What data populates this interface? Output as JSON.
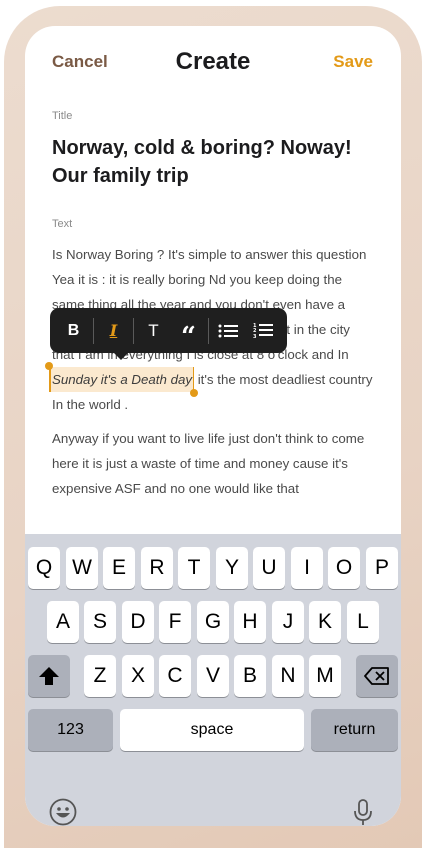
{
  "header": {
    "cancel": "Cancel",
    "title": "Create",
    "save": "Save"
  },
  "form": {
    "title_label": "Title",
    "title_value": "Norway, cold & boring? Noway! Our family trip",
    "text_label": "Text",
    "p1_line1": "Is Norway Boring ? It's simple to answer this question",
    "p1_line2": "Yea it is : it is really boring Nd you keep doing the",
    "p1_line3": "same thing all the year and you don't even have a",
    "p1_line4": "what in the city",
    "p1_line5": "that I am in everything I is close at 8 o'clock and In",
    "selected": "Sunday it's a Death day",
    "p1_after": " it's the most deadliest country",
    "p1_line7": "In the world .",
    "p2": "Anyway if you want to live life just don't think to come here it is just a waste of time and money cause it's expensive ASF and no one would like that"
  },
  "toolbar": {
    "bold": "B",
    "italic": "I",
    "text": "T",
    "quote": "“",
    "bullet_icon": "bulleted-list-icon",
    "number_icon": "numbered-list-icon",
    "accent": "#e39a18"
  },
  "keyboard": {
    "row1": [
      "Q",
      "W",
      "E",
      "R",
      "T",
      "Y",
      "U",
      "I",
      "O",
      "P"
    ],
    "row2": [
      "A",
      "S",
      "D",
      "F",
      "G",
      "H",
      "J",
      "K",
      "L"
    ],
    "row3": [
      "Z",
      "X",
      "C",
      "V",
      "B",
      "N",
      "M"
    ],
    "numbers": "123",
    "space": "space",
    "return": "return"
  }
}
